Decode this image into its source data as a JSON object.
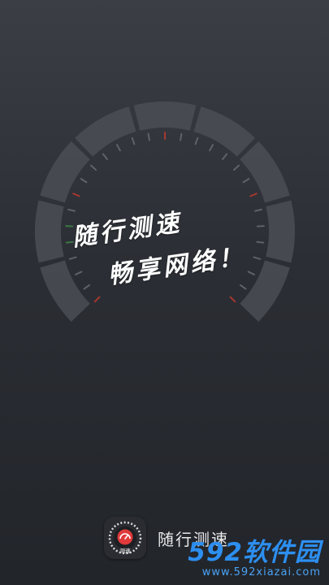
{
  "splash": {
    "slogan_line1": "随行测速",
    "slogan_line2": "畅享网络！"
  },
  "app": {
    "name": "随行测速",
    "icon_label": "测速",
    "icon_name": "speedometer-icon"
  },
  "watermark": {
    "brand": "592软件园",
    "url": "www.592xiazai.com"
  },
  "colors": {
    "background_top": "#3b3e45",
    "background_bottom": "#22252a",
    "gauge_segment": "#4b4e55",
    "tick_red": "#c23a2e",
    "tick_green": "#3f8a4a",
    "tick_gray": "#6b6e74",
    "icon_accent": "#e03a3a",
    "watermark_blue": "#2d8ff0"
  }
}
